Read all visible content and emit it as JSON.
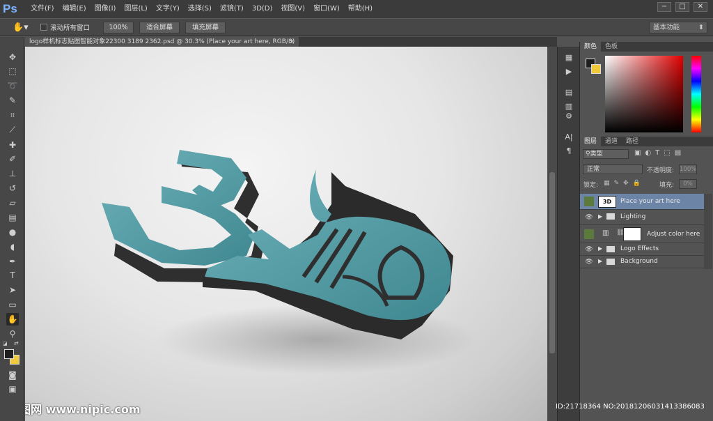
{
  "app": {
    "logo": "Ps"
  },
  "menu": [
    "文件(F)",
    "编辑(E)",
    "图像(I)",
    "图层(L)",
    "文字(Y)",
    "选择(S)",
    "滤镜(T)",
    "3D(D)",
    "视图(V)",
    "窗口(W)",
    "帮助(H)"
  ],
  "window_controls": {
    "minimize": "−",
    "restore": "□",
    "close": "✕"
  },
  "options": {
    "scroll_all_label": "滚动所有窗口",
    "zoom_100": "100%",
    "fit_screen": "适合屏幕",
    "fill_screen": "填充屏幕",
    "workspace": "基本功能"
  },
  "document": {
    "tab_title": "logo样机标志贴图智能对象22300 3189 2362.psd @ 30.3% (Place your art here, RGB/8)",
    "tab_close": "×"
  },
  "color_panel": {
    "tabs": [
      "颜色",
      "色板"
    ]
  },
  "layers_panel": {
    "tabs": [
      "图层",
      "通道",
      "路径"
    ],
    "filter_label": "类型",
    "blend_mode": "正常",
    "opacity_label": "不透明度:",
    "opacity_value": "100%",
    "lock_label": "锁定:",
    "fill_label": "填充:",
    "fill_value": "0%",
    "layers": [
      {
        "name": "Place your art here",
        "type": "smart-object",
        "selected": true
      },
      {
        "name": "Lighting",
        "type": "group"
      },
      {
        "name": "Adjust color here",
        "type": "adjustment"
      },
      {
        "name": "Logo Effects",
        "type": "group"
      },
      {
        "name": "Background",
        "type": "group"
      }
    ]
  },
  "overlay": {
    "watermark": "昵图网 www.nipic.com",
    "id_stamp": "ID:21718364 NO:20181206031413386083"
  },
  "colors": {
    "accent_selected": "#6c84a6",
    "logo_teal": "#4e9aa3",
    "foreground": "#1e1e1e",
    "background_swatch": "#f0c93a"
  }
}
